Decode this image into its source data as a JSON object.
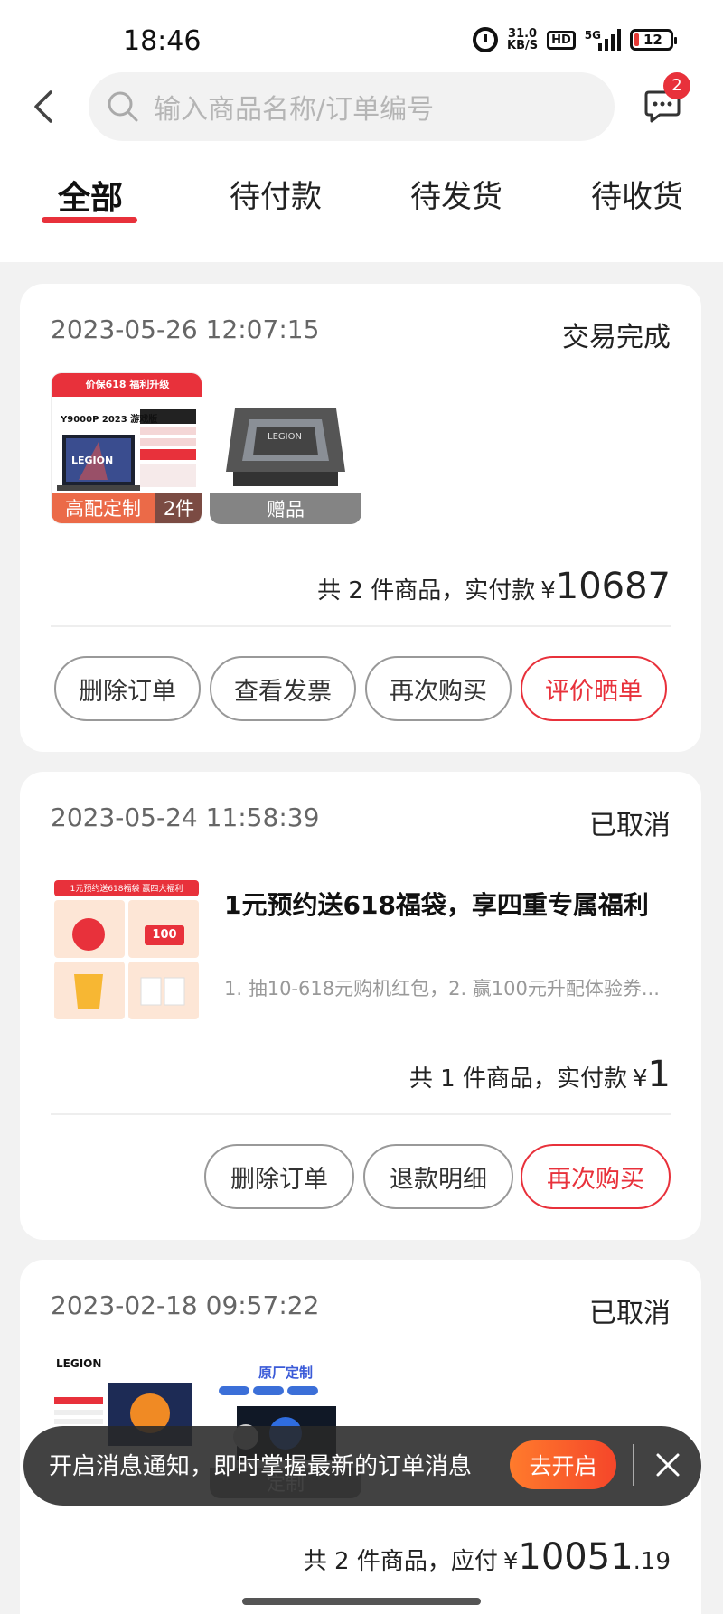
{
  "status_bar": {
    "time": "18:46",
    "net_speed_value": "31.0",
    "net_speed_unit": "KB/S",
    "hd": "HD",
    "network": "5G",
    "battery": "12"
  },
  "header": {
    "search_placeholder": "输入商品名称/订单编号",
    "message_badge": "2"
  },
  "tabs": [
    {
      "label": "全部",
      "active": true
    },
    {
      "label": "待付款"
    },
    {
      "label": "待发货"
    },
    {
      "label": "待收货"
    }
  ],
  "orders": [
    {
      "date": "2023-05-26 12:07:15",
      "status": "交易完成",
      "items": [
        {
          "banner": "价保618 福利升级",
          "model": "Y9000P 2023 游戏版",
          "brand": "LEGION",
          "tag": "高配定制",
          "count": "2件"
        },
        {
          "brand": "LEGION",
          "tag": "赠品"
        }
      ],
      "summary": {
        "prefix": "共 2 件商品，实付款",
        "currency": "¥",
        "amount": "10687",
        "decimal": ""
      },
      "buttons": [
        {
          "label": "删除订单"
        },
        {
          "label": "查看发票"
        },
        {
          "label": "再次购买"
        },
        {
          "label": "评价晒单",
          "accent": true
        }
      ]
    },
    {
      "date": "2023-05-24 11:58:39",
      "status": "已取消",
      "promo": {
        "title": "1元预约送618福袋，享四重专属福利",
        "desc": "1. 抽10-618元购机红包，2. 赢100元升配体验券...",
        "image_banner": "1元预约送618福袋 赢四大福利",
        "coupon": "100"
      },
      "summary": {
        "prefix": "共 1 件商品，实付款",
        "currency": "¥",
        "amount": "1",
        "decimal": ""
      },
      "buttons": [
        {
          "label": "删除订单"
        },
        {
          "label": "退款明细"
        },
        {
          "label": "再次购买",
          "accent": true
        }
      ]
    },
    {
      "date": "2023-02-18 09:57:22",
      "status": "已取消",
      "items": [
        {
          "brand": "LEGION"
        },
        {
          "title": "原厂定制",
          "tag": "定制"
        }
      ],
      "summary": {
        "prefix": "共 2 件商品，应付",
        "currency": "¥",
        "amount": "10051",
        "decimal": ".19"
      }
    }
  ],
  "toast": {
    "text": "开启消息通知，即时掌握最新的订单消息",
    "button": "去开启"
  },
  "colors": {
    "accent": "#e8313b",
    "toast_button": "#f5462a"
  }
}
